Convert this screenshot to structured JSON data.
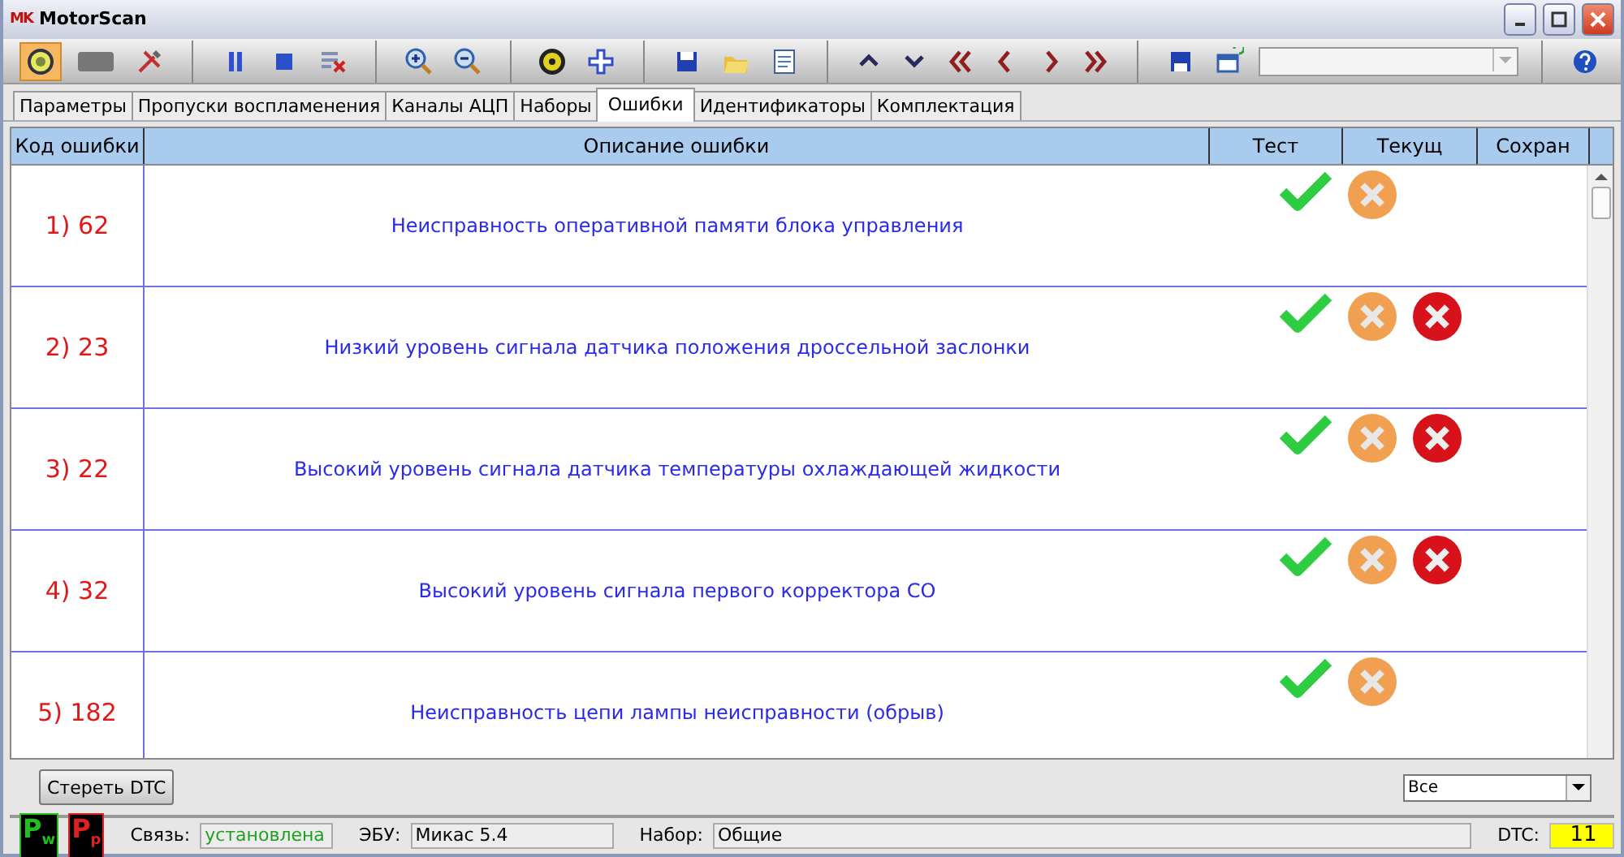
{
  "window": {
    "logo": "MK",
    "title": "MotorScan"
  },
  "tabs": [
    {
      "label": "Параметры",
      "selected": false
    },
    {
      "label": "Пропуски воспламенения",
      "selected": false
    },
    {
      "label": "Каналы АЦП",
      "selected": false
    },
    {
      "label": "Наборы",
      "selected": false
    },
    {
      "label": "Ошибки",
      "selected": true
    },
    {
      "label": "Идентификаторы",
      "selected": false
    },
    {
      "label": "Комплектация",
      "selected": false
    }
  ],
  "table": {
    "columns": [
      "Код ошибки",
      "Описание ошибки",
      "Тест",
      "Текущ",
      "Сохран"
    ],
    "rows": [
      {
        "code": "1) 62",
        "description": "Неисправность оперативной памяти блока управления",
        "test": true,
        "current": false,
        "stored": false
      },
      {
        "code": "2) 23",
        "description": "Низкий уровень сигнала датчика положения дроссельной заслонки",
        "test": true,
        "current": false,
        "stored": true
      },
      {
        "code": "3) 22",
        "description": "Высокий уровень сигнала датчика температуры охлаждающей жидкости",
        "test": true,
        "current": false,
        "stored": true
      },
      {
        "code": "4) 32",
        "description": "Высокий уровень сигнала первого корректора СО",
        "test": true,
        "current": false,
        "stored": true
      },
      {
        "code": "5) 182",
        "description": "Неисправность цепи лампы неисправности (обрыв)",
        "test": true,
        "current": false,
        "stored": false
      }
    ]
  },
  "footer": {
    "clear_button": "Стереть DTC",
    "filter": "Все"
  },
  "status_bar": {
    "indicators": [
      {
        "text": "P$_{w}$",
        "color": "#20c020"
      },
      {
        "text": "P$_{p}$",
        "color": "#e02020"
      }
    ],
    "connection_label": "Связь:",
    "connection": "установлена",
    "ecu_label": "ЭБУ:",
    "ecu": "Микас 5.4",
    "set_label": "Набор:",
    "set": "Общие",
    "dtc_label": "DTC:",
    "dtc": "11"
  }
}
